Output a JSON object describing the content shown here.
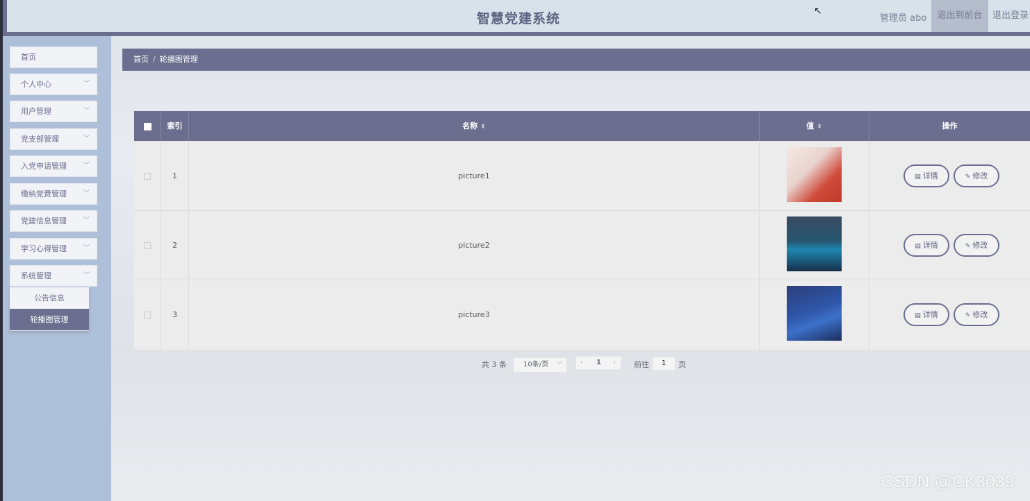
{
  "header": {
    "title": "智慧党建系统",
    "user_label": "管理员 abo",
    "to_front": "退出到前台",
    "logout": "退出登录"
  },
  "sidebar": {
    "items": [
      {
        "label": "首页"
      },
      {
        "label": "个人中心"
      },
      {
        "label": "用户管理"
      },
      {
        "label": "党支部管理"
      },
      {
        "label": "入党申请管理"
      },
      {
        "label": "缴纳党费管理"
      },
      {
        "label": "党建信息管理"
      },
      {
        "label": "学习心得管理"
      },
      {
        "label": "系统管理"
      }
    ],
    "submenu": [
      {
        "label": "公告信息"
      },
      {
        "label": "轮播图管理",
        "active": true
      }
    ]
  },
  "breadcrumb": {
    "home": "首页",
    "separator": "/",
    "current": "轮播图管理"
  },
  "table": {
    "headers": {
      "index": "索引",
      "name": "名称",
      "value": "值",
      "ops": "操作"
    },
    "rows": [
      {
        "index": "1",
        "name": "picture1"
      },
      {
        "index": "2",
        "name": "picture2"
      },
      {
        "index": "3",
        "name": "picture3"
      }
    ],
    "detail_label": "详情",
    "edit_label": "修改"
  },
  "pagination": {
    "total": "共 3 条",
    "page_size": "10条/页",
    "current_page": "1",
    "goto_label": "前往",
    "goto_value": "1",
    "page_unit": "页"
  },
  "watermark": "CSDN @CK3039",
  "colors": {
    "accent": "#6b6e8f",
    "sidebar_bg": "#aebfd9",
    "header_bg": "#d7e2ea"
  }
}
